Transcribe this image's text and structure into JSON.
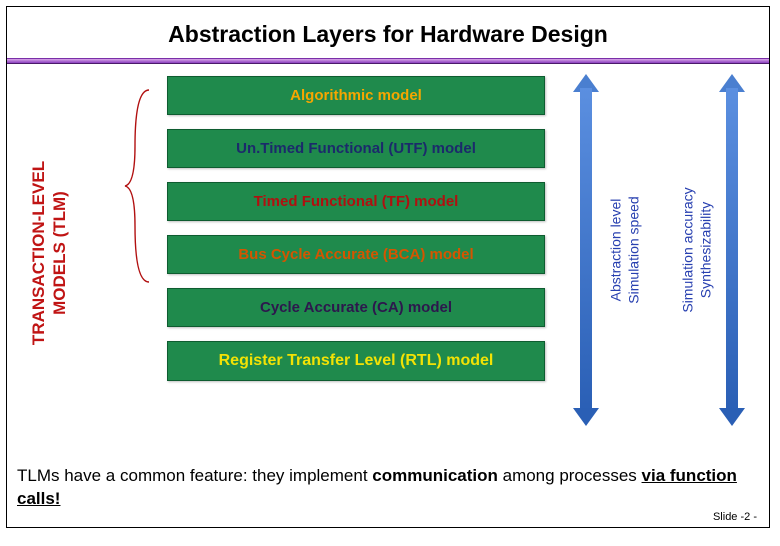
{
  "title": "Abstraction Layers for Hardware Design",
  "tlm_label_line1": "TRANSACTION-LEVEL",
  "tlm_label_line2": "MODELS (TLM)",
  "models": {
    "alg": "Algorithmic model",
    "utf": "Un.Timed Functional (UTF) model",
    "tf": "Timed Functional (TF) model",
    "bca": "Bus Cycle Accurate (BCA) model",
    "ca": "Cycle Accurate (CA) model",
    "rtl": "Register Transfer Level (RTL) model"
  },
  "left_axis_line1": "Abstraction level",
  "left_axis_line2": "Simulation speed",
  "right_axis_line1": "Simulation accuracy",
  "right_axis_line2": "Synthesizability",
  "footer_part1": "TLMs have a common feature: they implement ",
  "footer_bold1": "communication",
  "footer_part2": " among processes ",
  "footer_bold2": "via function calls!",
  "slide": "Slide -2 -"
}
